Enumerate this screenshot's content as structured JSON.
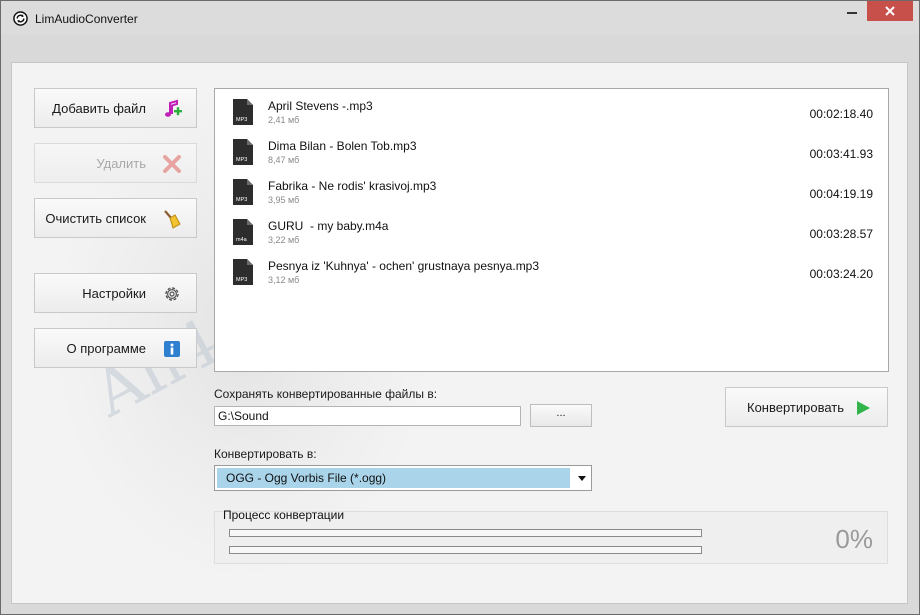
{
  "window": {
    "title": "LimAudioConverter",
    "icons": {
      "app": "refresh-circle-icon",
      "minimize": "minimize-icon",
      "close": "close-icon"
    },
    "close_color": "#c7504a"
  },
  "sidebar": {
    "add_file": {
      "label": "Добавить файл",
      "icon": "music-note-add-icon"
    },
    "delete": {
      "label": "Удалить",
      "icon": "red-x-icon",
      "disabled": true
    },
    "clear_list": {
      "label": "Очистить список",
      "icon": "broom-icon"
    },
    "settings": {
      "label": "Настройки",
      "icon": "gear-icon"
    },
    "about": {
      "label": "О программе",
      "icon": "info-icon"
    }
  },
  "files": [
    {
      "name": "April Stevens -.mp3",
      "size": "2,41 мб",
      "duration": "00:02:18.40",
      "badge": "MP3"
    },
    {
      "name": "Dima Bilan - Bolen Tob.mp3",
      "size": "8,47 мб",
      "duration": "00:03:41.93",
      "badge": "MP3"
    },
    {
      "name": "Fabrika - Ne rodis' krasivoj.mp3",
      "size": "3,95 мб",
      "duration": "00:04:19.19",
      "badge": "MP3"
    },
    {
      "name": "GURU  - my baby.m4a",
      "size": "3,22 мб",
      "duration": "00:03:28.57",
      "badge": "m4a"
    },
    {
      "name": "Pesnya iz 'Kuhnya' - ochen' grustnaya pesnya.mp3",
      "size": "3,12 мб",
      "duration": "00:03:24.20",
      "badge": "MP3"
    }
  ],
  "output": {
    "save_label": "Сохранять конвертированные файлы в:",
    "path_value": "G:\\Sound",
    "browse_label": "...",
    "format_label": "Конвертировать в:",
    "format_selected": "OGG - Ogg Vorbis File (*.ogg)",
    "select_color": "#a9d4ea"
  },
  "convert": {
    "label": "Конвертировать",
    "icon": "play-icon",
    "icon_color": "#2fb34a"
  },
  "progress": {
    "label": "Процесс конвертации",
    "percent_text": "0%",
    "bar1": 0,
    "bar2": 0
  },
  "watermark": "All4OS.RU"
}
